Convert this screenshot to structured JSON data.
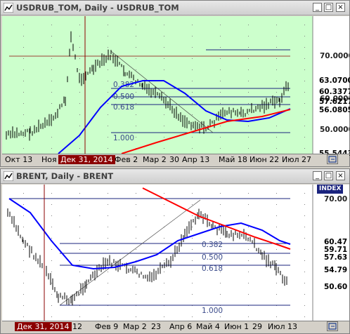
{
  "window1": {
    "title": "USDRUB_TOM, Daily - USDRUB_TOM",
    "controls": {
      "minimize": "_",
      "restore": "□",
      "close": "×"
    },
    "fib_labels": [
      "0.382",
      "0.500",
      "0.618",
      "1.000"
    ],
    "price_axis": [
      "70.0000",
      "60.0000",
      "50.0000"
    ],
    "price_tags": [
      {
        "text": "63.0700",
        "color": "#000000",
        "bg": "#ffffff"
      },
      {
        "text": "60.3377",
        "color": "#000000",
        "bg": "#ffffff"
      },
      {
        "text": "57.6217",
        "color": "#000000",
        "bg": "#ffffff"
      },
      {
        "text": "56.0805",
        "color": "#000000",
        "bg": "#ffffff"
      },
      {
        "text": "55.5443",
        "color": "#000000",
        "bg": "#ffffff"
      }
    ],
    "time_axis": [
      "Окт 13",
      "Ноя",
      "Дек 31, 2014",
      "Фев 2",
      "Мар 2",
      "30",
      "Апр 13",
      "Май 18",
      "Июн 22",
      "Июл 27"
    ],
    "highlight_label": "Дек 31, 2014"
  },
  "window2": {
    "title": "BRENT, Daily - BRENT",
    "controls": {
      "minimize": "_",
      "restore": "□",
      "close": "×"
    },
    "index_badge": "INDEX",
    "fib_labels": [
      "0.382",
      "0.500",
      "0.618",
      "1.000"
    ],
    "price_axis": [
      "70.00"
    ],
    "price_tags": [
      {
        "text": "60.47",
        "color": "#000000",
        "bg": "#ffffff"
      },
      {
        "text": "59.71",
        "color": "#000000",
        "bg": "#ffffff"
      },
      {
        "text": "57.63",
        "color": "#000000",
        "bg": "#ffffff"
      },
      {
        "text": "54.79",
        "color": "#000000",
        "bg": "#ffffff"
      },
      {
        "text": "50.60",
        "color": "#000000",
        "bg": "#ffffff"
      }
    ],
    "time_axis": [
      "Дек 31, 2014",
      "12",
      "Фев 9",
      "Мар 2",
      "23",
      "Апр 6",
      "Май 4",
      "Июн 1",
      "29",
      "Июл 13"
    ],
    "highlight_label": "Дек 31, 2014"
  },
  "colors": {
    "chart_bg_top": "#ccffcc",
    "chart_bg_bottom": "#ffffff",
    "candle": "#000000",
    "ma_fast": "#0000ff",
    "ma_slow": "#ff0000",
    "fib_line": "#1a237e",
    "vline": "#8b0000"
  }
}
